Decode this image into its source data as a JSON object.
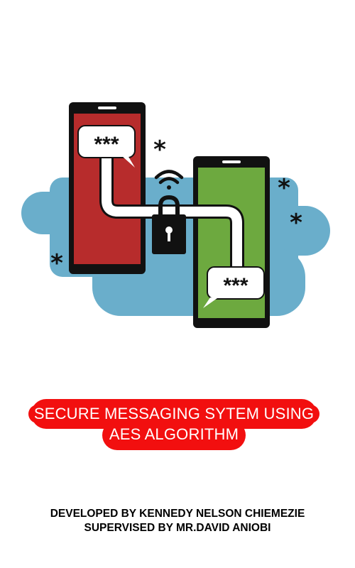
{
  "hero": {
    "left_phone_bubble": "***",
    "right_phone_bubble": "***",
    "colors": {
      "left_phone_screen": "#b72c2c",
      "right_phone_screen": "#6da93f",
      "cloud": "#6aaecb",
      "frame": "#111111",
      "wire": "#ffffff"
    },
    "icons": [
      "wifi-icon",
      "padlock-icon",
      "asterisk-icon"
    ]
  },
  "title": {
    "line1": "SECURE MESSAGING SYTEM USING",
    "line2": "AES ALGORITHM",
    "background_color": "#f20f0f"
  },
  "credits": {
    "developer": "DEVELOPED BY KENNEDY NELSON CHIEMEZIE",
    "supervisor": "SUPERVISED BY MR.DAVID ANIOBI"
  }
}
